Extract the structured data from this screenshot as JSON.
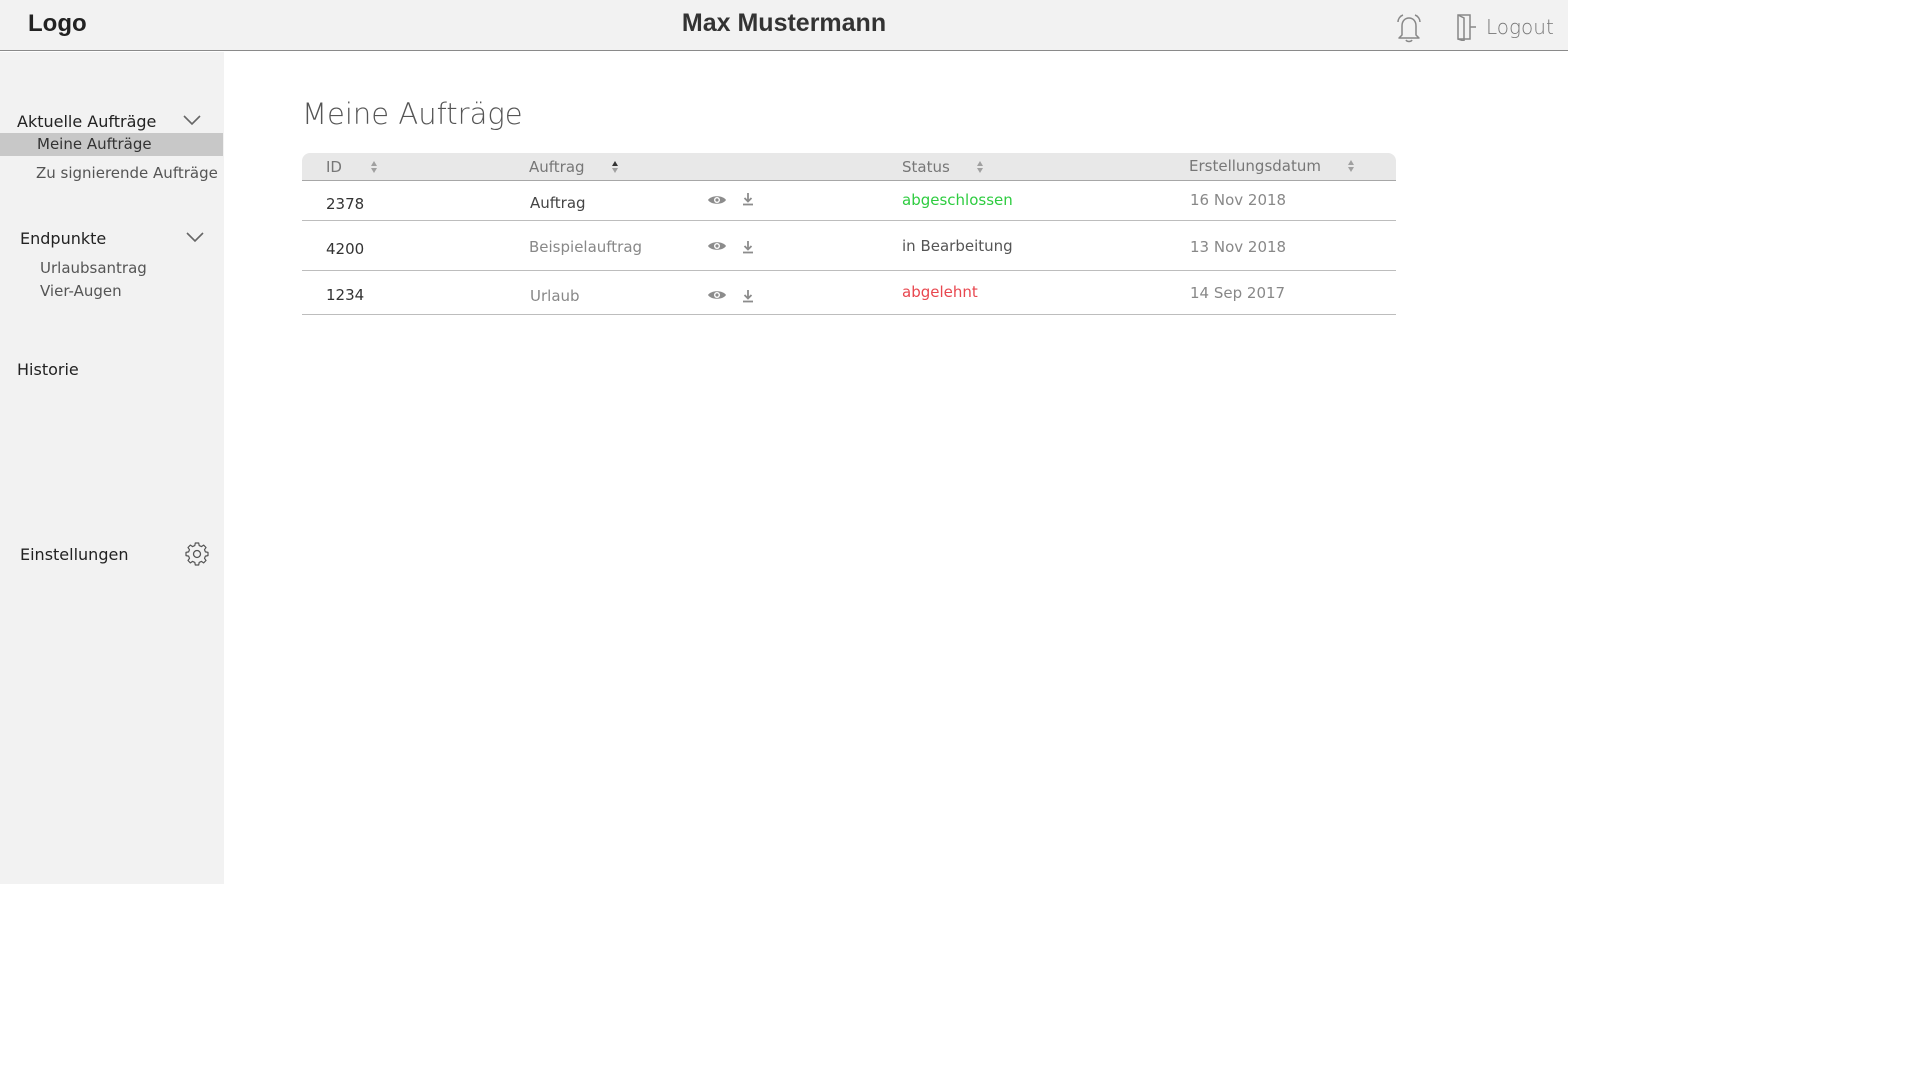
{
  "header": {
    "logo": "Logo",
    "user": "Max Mustermann",
    "logout_label": "Logout",
    "bell_icon": "bell-icon",
    "logout_icon": "door-exit-icon"
  },
  "sidebar": {
    "groups": [
      {
        "label": "Aktuelle Aufträge",
        "expanded": true,
        "items": [
          {
            "label": "Meine Aufträge",
            "active": true
          },
          {
            "label": "Zu signierende Aufträge",
            "active": false
          }
        ]
      },
      {
        "label": "Endpunkte",
        "expanded": true,
        "items": [
          {
            "label": "Urlaubsantrag"
          },
          {
            "label": "Vier-Augen"
          }
        ]
      }
    ],
    "history_label": "Historie",
    "settings_label": "Einstellungen",
    "settings_icon": "gear-icon"
  },
  "main": {
    "title": "Meine Aufträge",
    "columns": [
      {
        "label": "ID",
        "sort": "none"
      },
      {
        "label": "Auftrag",
        "sort": "ascending"
      },
      {
        "label": "Status",
        "sort": "none"
      },
      {
        "label": "Erstellungsdatum",
        "sort": "none"
      }
    ],
    "rows": [
      {
        "id": "2378",
        "auftrag": "Auftrag",
        "status": "abgeschlossen",
        "status_color": "#2ecc40",
        "date": "16 Nov 2018"
      },
      {
        "id": "4200",
        "auftrag": "Beispielauftrag",
        "status": "in Bearbeitung",
        "status_color": "#555555",
        "date": "13 Nov 2018"
      },
      {
        "id": "1234",
        "auftrag": "Urlaub",
        "status": "abgelehnt",
        "status_color": "#e8474f",
        "date": "14 Sep 2017"
      }
    ],
    "row_icons": [
      "eye-icon",
      "download-icon"
    ]
  }
}
